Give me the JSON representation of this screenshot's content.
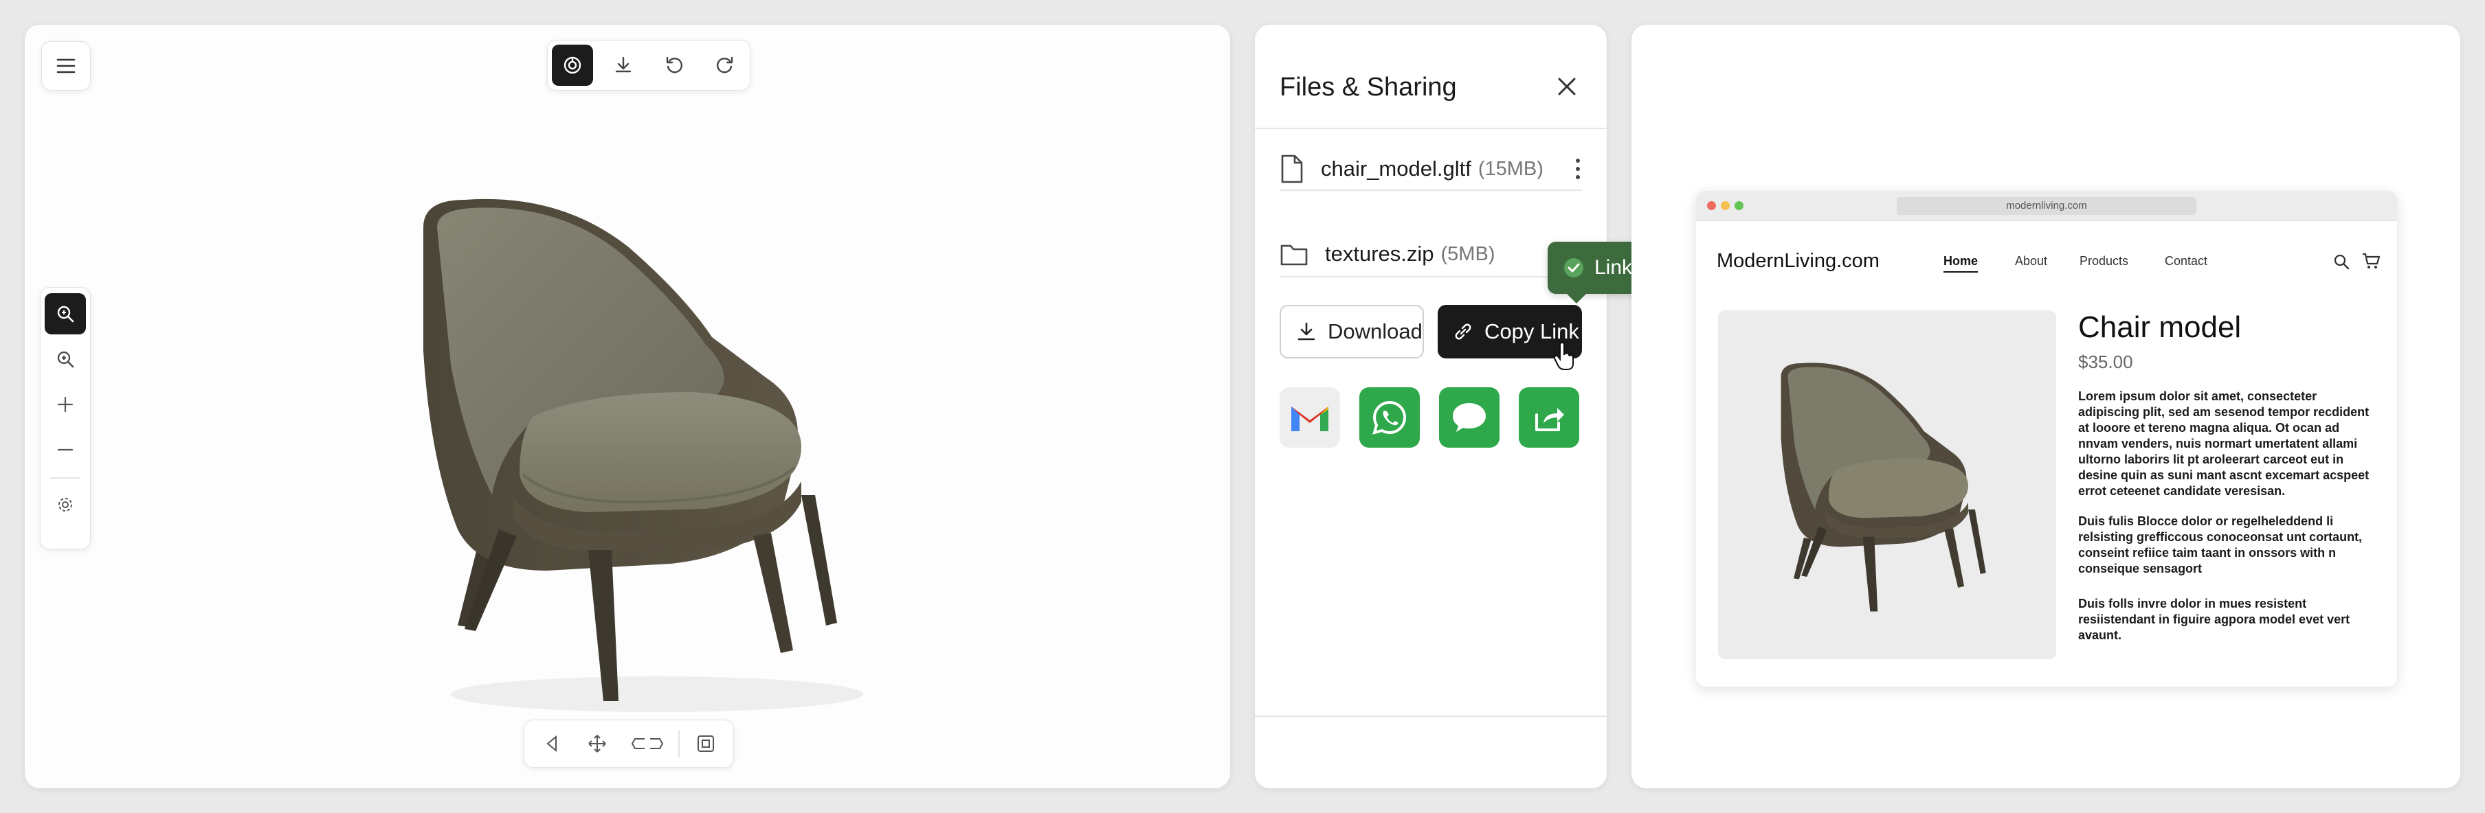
{
  "viewer": {
    "top_toolbar": [
      {
        "icon": "ar-icon",
        "active": true
      },
      {
        "icon": "download-icon",
        "active": false
      },
      {
        "icon": "undo-icon",
        "active": false
      },
      {
        "icon": "redo-icon",
        "active": false
      }
    ],
    "side_toolbar": [
      "zoom-fit-icon",
      "zoom-in-icon",
      "plus-icon",
      "minus-icon",
      "settings-icon"
    ],
    "bottom_toolbar": [
      "rotate-icon",
      "pan-icon",
      "orbit-icon",
      "fullscreen-icon"
    ]
  },
  "files_panel": {
    "title": "Files & Sharing",
    "files": [
      {
        "name": "chair_model.gltf",
        "size": "(15MB)",
        "icon": "file-icon"
      },
      {
        "name": "textures.zip",
        "size": "(5MB)",
        "icon": "folder-icon"
      }
    ],
    "download_label": "Download",
    "copy_link_label": "Copy Link",
    "toast": "Link Copied!",
    "share_targets": [
      "gmail-icon",
      "whatsapp-icon",
      "messages-icon",
      "share-icon"
    ],
    "colors": {
      "toast": "#3d6b3e",
      "copy_button": "#1a1a1a",
      "share_green": "#2ea84a"
    }
  },
  "preview": {
    "url": "modernliving.com",
    "brand": "ModernLiving.com",
    "nav": [
      "Home",
      "About",
      "Products",
      "Contact"
    ],
    "product_title": "Chair model",
    "price": "$35.00",
    "paragraphs": [
      "Lorem ipsum dolor sit amet, consecteter adipiscing plit, sed am sesenod tempor recdident at looore et tereno magna aliqua. Ot ocan ad nnvam venders, nuis normart umertatent allami ultorno laborirs lit pt aroleerart carceot eut in desine quin as suni mant ascnt excemart acspeet errot ceteenet candidate veresisan.",
      "Duis fulis Blocce dolor or regelheleddend li relsisting grefficcous conoceonsat unt cortaunt, conseint refiice taim taant in onssors with n conseique sensagort",
      "Duis folls invre dolor in mues resistent resiistendant in figuire agpora model evet vert avaunt."
    ]
  }
}
